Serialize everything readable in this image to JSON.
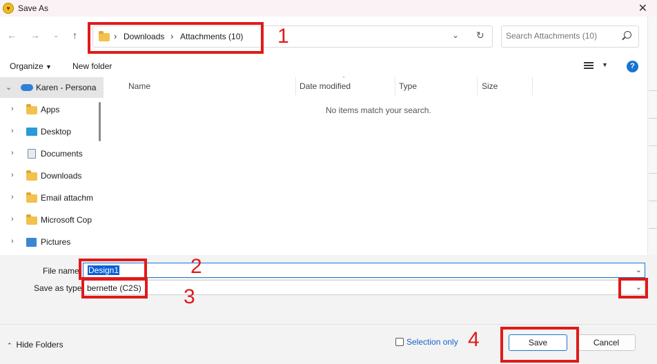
{
  "window": {
    "title": "Save As"
  },
  "address": {
    "crumbs": [
      "Downloads",
      "Attachments (10)"
    ]
  },
  "search": {
    "placeholder": "Search Attachments (10)"
  },
  "toolbar": {
    "organize_label": "Organize",
    "new_folder_label": "New folder",
    "help_label": "?"
  },
  "nav_pane": {
    "items": [
      {
        "label": "Karen - Persona",
        "icon": "cloud-icon",
        "expanded": true,
        "selected": true
      },
      {
        "label": "Apps",
        "icon": "folder-icon"
      },
      {
        "label": "Desktop",
        "icon": "desktop-icon"
      },
      {
        "label": "Documents",
        "icon": "documents-icon"
      },
      {
        "label": "Downloads",
        "icon": "folder-icon"
      },
      {
        "label": "Email attachm",
        "icon": "folder-icon"
      },
      {
        "label": "Microsoft Cop",
        "icon": "folder-icon"
      },
      {
        "label": "Pictures",
        "icon": "pictures-icon"
      }
    ]
  },
  "file_list": {
    "columns": [
      "Name",
      "Date modified",
      "Type",
      "Size"
    ],
    "empty_message": "No items match your search."
  },
  "form": {
    "file_name_label": "File name:",
    "file_name_value": "Design1",
    "save_as_type_label": "Save as type:",
    "save_as_type_value": "bernette (C2S)"
  },
  "footer": {
    "hide_folders_label": "Hide Folders",
    "selection_only_label": "Selection only",
    "save_label": "Save",
    "cancel_label": "Cancel"
  },
  "annotations": {
    "labels": [
      "1",
      "2",
      "3",
      "4"
    ],
    "color": "#e01a1a"
  }
}
